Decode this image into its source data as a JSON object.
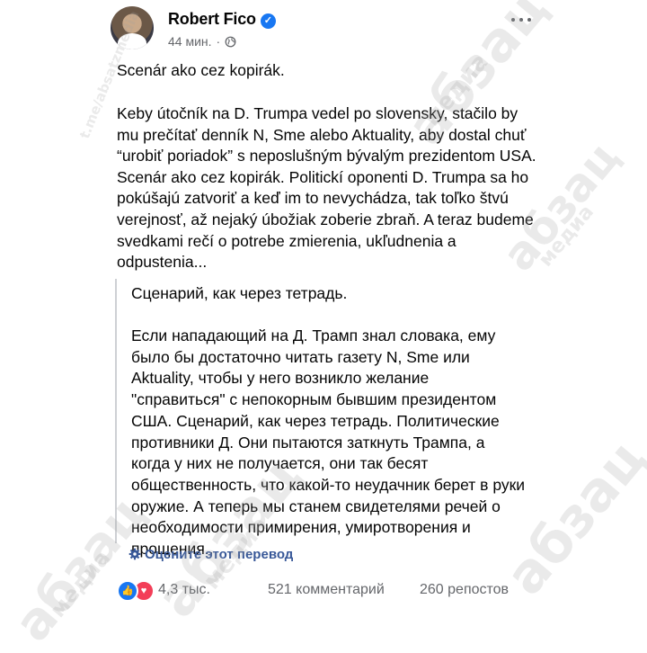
{
  "post": {
    "author": "Robert Fico",
    "time": "44 мин.",
    "dot": "·",
    "text_lead": "Scenár ako cez kopirák.",
    "text_body": "Keby útočník na D. Trumpa vedel po slovensky, stačilo by mu prečítať denník N, Sme alebo Aktuality, aby dostal chuť  “urobiť poriadok” s neposlušným bývalým prezidentom USA. Scenár ako cez kopirák. Politickí oponenti D. Trumpa sa ho pokúšajú zatvoriť a keď im to nevychádza, tak toľko štvú verejnosť, až nejaký úbožiak zoberie zbraň. A teraz budeme svedkami rečí o potrebe zmierenia, ukľudnenia a odpustenia...",
    "translation_lead": "Сценарий, как через тетрадь.",
    "translation_body": "Если нападающий на Д. Трамп знал словака, ему было бы достаточно читать газету N, Sme или Aktuality, чтобы у него возникло желание \"справиться\" с непокорным бывшим президентом США. Сценарий, как через тетрадь. Политические противники Д. Они пытаются заткнуть Трампа, а когда у них не получается, они так бесят общественность, что какой-то неудачник берет в руки оружие. А теперь мы станем свидетелями речей о необходимости примирения, умиротворения и прощения..",
    "rate_translation": "Оцените этот перевод"
  },
  "footer": {
    "reactions": "4,3 тыс.",
    "comments": "521 комментарий",
    "shares": "260 репостов"
  },
  "watermarks": {
    "channel": "t.me/absatzmedia",
    "brand": "абзац",
    "brand_sub": "медиа"
  },
  "colors": {
    "accent": "#1877f2",
    "love": "#f33e58",
    "link": "#385898",
    "muted": "#65676b"
  },
  "icons": {
    "verified": "verified-badge-icon",
    "audience": "globe-icon",
    "more": "more-dots-icon",
    "rate": "gear-icon",
    "like": "like-icon",
    "love": "love-icon"
  }
}
